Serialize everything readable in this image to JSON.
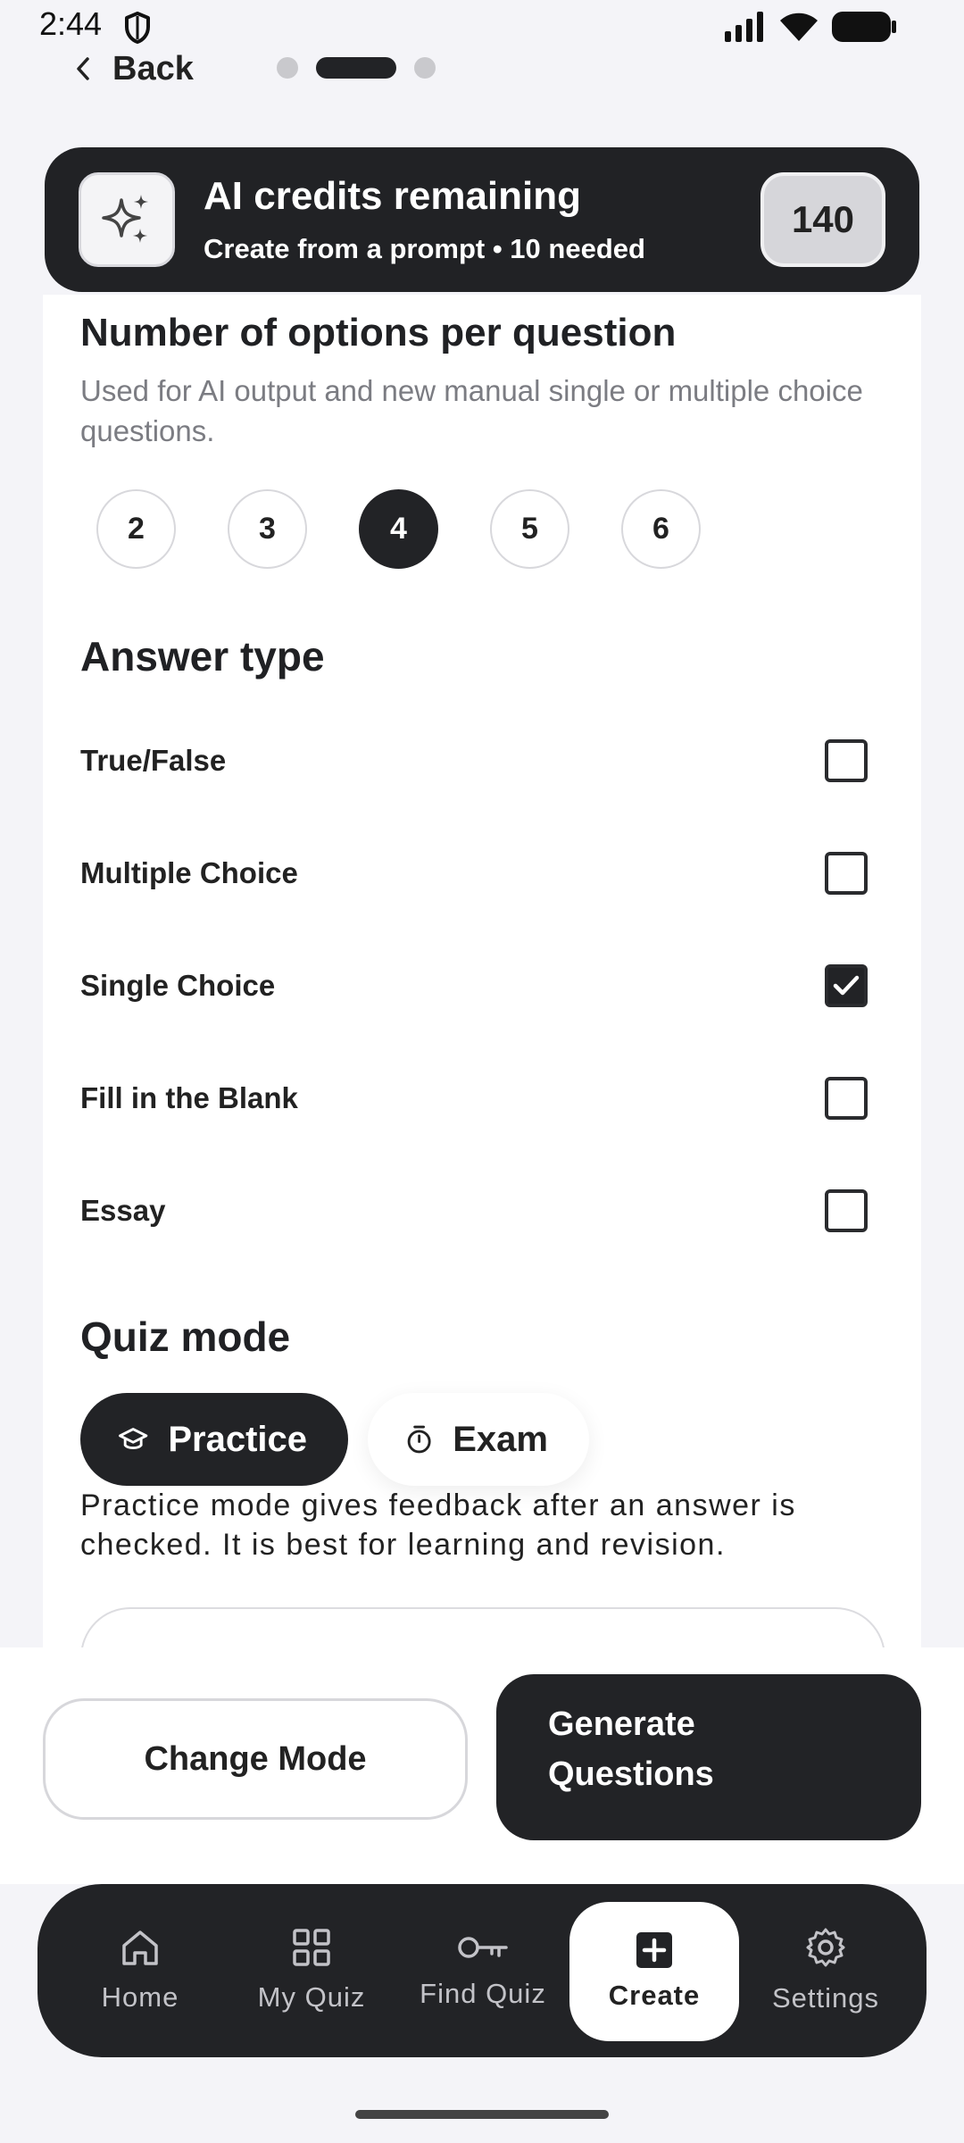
{
  "status_bar": {
    "time": "2:44"
  },
  "nav": {
    "back_label": "Back"
  },
  "credits": {
    "title": "AI credits remaining",
    "subtitle": "Create from a prompt • 10 needed",
    "count": "140"
  },
  "options_section": {
    "title": "Number of options per question",
    "description": "Used for AI output and new manual single or multiple choice questions.",
    "options": [
      "2",
      "3",
      "4",
      "5",
      "6"
    ],
    "selected": "4"
  },
  "answer_type": {
    "title": "Answer type",
    "items": [
      {
        "label": "True/False",
        "checked": false
      },
      {
        "label": "Multiple Choice",
        "checked": false
      },
      {
        "label": "Single Choice",
        "checked": true
      },
      {
        "label": "Fill in the Blank",
        "checked": false
      },
      {
        "label": "Essay",
        "checked": false
      }
    ]
  },
  "quiz_mode": {
    "title": "Quiz mode",
    "practice_label": "Practice",
    "exam_label": "Exam",
    "selected": "Practice",
    "description": "Practice mode gives feedback after an answer is checked. It is best for learning and revision."
  },
  "actions": {
    "change_mode_label": "Change Mode",
    "generate_line1": "Generate",
    "generate_line2": "Questions"
  },
  "bottom_nav": {
    "items": [
      {
        "label": "Home",
        "icon": "home-icon"
      },
      {
        "label": "My Quiz",
        "icon": "grid-icon"
      },
      {
        "label": "Find Quiz",
        "icon": "key-icon"
      },
      {
        "label": "Create",
        "icon": "plus-square-icon"
      },
      {
        "label": "Settings",
        "icon": "gear-icon"
      }
    ],
    "active": "Create"
  }
}
